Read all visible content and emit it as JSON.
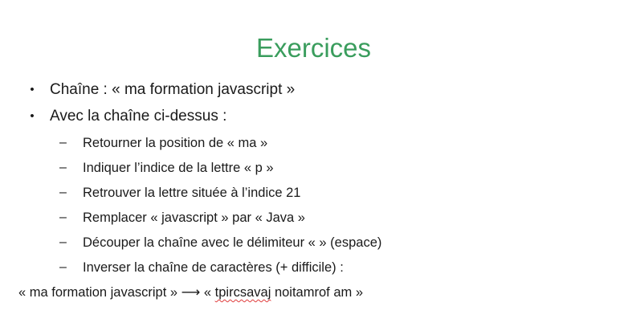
{
  "title": "Exercices",
  "bullets": [
    "Chaîne : « ma formation javascript »",
    "Avec la chaîne ci-dessus :"
  ],
  "bullet_marker": "•",
  "sub_marker": "–",
  "subitems": [
    "Retourner la position de « ma »",
    "Indiquer l’indice de la lettre « p »",
    "Retrouver la lettre située à l’indice 21",
    "Remplacer « javascript » par « Java »",
    "Découper la chaîne avec le délimiteur «  » (espace)",
    "Inverser la chaîne de caractères (+ difficile) :"
  ],
  "example": {
    "input": "« ma formation javascript » ⟶ « ",
    "flagged_word": "tpircsavaj",
    "rest": " noitamrof am »"
  },
  "colors": {
    "title": "#3a9d5d",
    "text": "#1a1a1a",
    "spellcheck_underline": "#e03c3c"
  }
}
